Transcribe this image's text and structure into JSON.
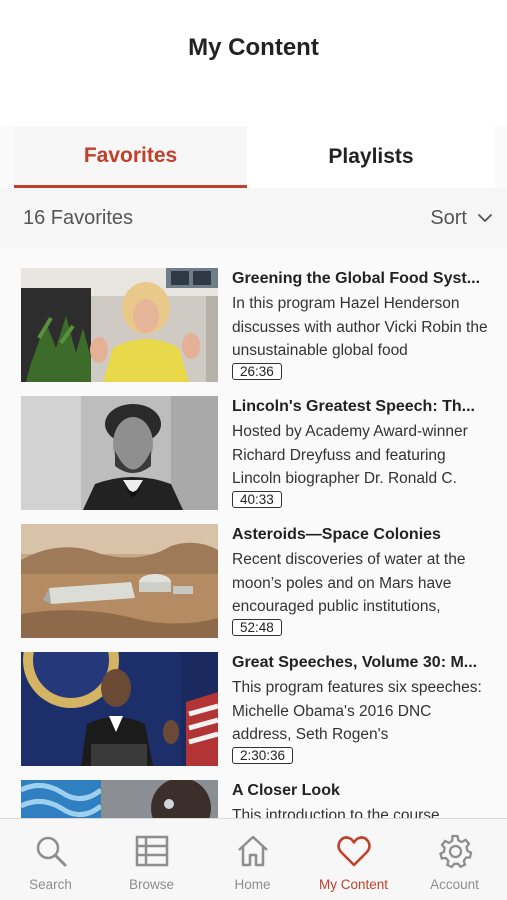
{
  "page": {
    "title": "My Content"
  },
  "tabs": {
    "favorites": "Favorites",
    "playlists": "Playlists",
    "active": "favorites"
  },
  "list_header": {
    "count": "16 Favorites",
    "sort_label": "Sort"
  },
  "colors": {
    "accent": "#c0412b",
    "inactive": "#8e8e8e"
  },
  "items": [
    {
      "title": "Greening the Global Food Syst...",
      "description": "In this program Hazel Henderson discusses with author Vicki Robin the unsustainable global food",
      "duration": "26:36",
      "thumbnail": "woman-speaking-interview"
    },
    {
      "title": "Lincoln's Greatest Speech: Th...",
      "description": "Hosted by Academy Award-winner Richard Dreyfuss and featuring Lincoln biographer Dr. Ronald C.",
      "duration": "40:33",
      "thumbnail": "lincoln-portrait"
    },
    {
      "title": "Asteroids—Space Colonies",
      "description": "Recent discoveries of water at the moon’s poles and on Mars have encouraged public institutions,",
      "duration": "52:48",
      "thumbnail": "mars-colony"
    },
    {
      "title": "Great Speeches, Volume 30: M...",
      "description": "This program features six speeches: Michelle Obama's 2016 DNC address, Seth Rogen's",
      "duration": "2:30:36",
      "thumbnail": "podium-speech"
    },
    {
      "title": "A Closer Look",
      "description": "This introduction to the course",
      "duration": "",
      "thumbnail": "abstract-blue"
    }
  ],
  "tabbar": [
    {
      "label": "Search",
      "icon": "search-icon"
    },
    {
      "label": "Browse",
      "icon": "browse-icon"
    },
    {
      "label": "Home",
      "icon": "home-icon"
    },
    {
      "label": "My Content",
      "icon": "heart-icon"
    },
    {
      "label": "Account",
      "icon": "gear-icon"
    }
  ]
}
